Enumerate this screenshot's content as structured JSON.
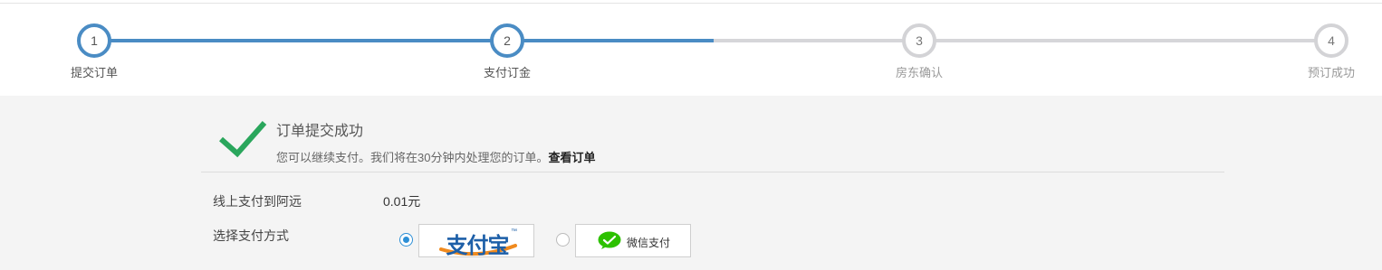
{
  "steps": [
    {
      "num": "1",
      "label": "提交订单",
      "state": "done"
    },
    {
      "num": "2",
      "label": "支付订金",
      "state": "current"
    },
    {
      "num": "3",
      "label": "房东确认",
      "state": "pending"
    },
    {
      "num": "4",
      "label": "预订成功",
      "state": "pending"
    }
  ],
  "success": {
    "title": "订单提交成功",
    "desc": "您可以继续支付。我们将在30分钟内处理您的订单。",
    "link": "查看订单"
  },
  "payment": {
    "online_label": "线上支付到阿远",
    "amount": "0.01元",
    "method_label": "选择支付方式",
    "methods": [
      {
        "name": "支付宝",
        "tm": "™",
        "selected": true
      },
      {
        "name": "微信支付",
        "selected": false
      }
    ]
  },
  "colors": {
    "accent": "#4a8cc4",
    "pending": "#d6d6d9",
    "success": "#2aa65c",
    "alipay": "#1d5fa8",
    "wechat": "#2dc100"
  }
}
